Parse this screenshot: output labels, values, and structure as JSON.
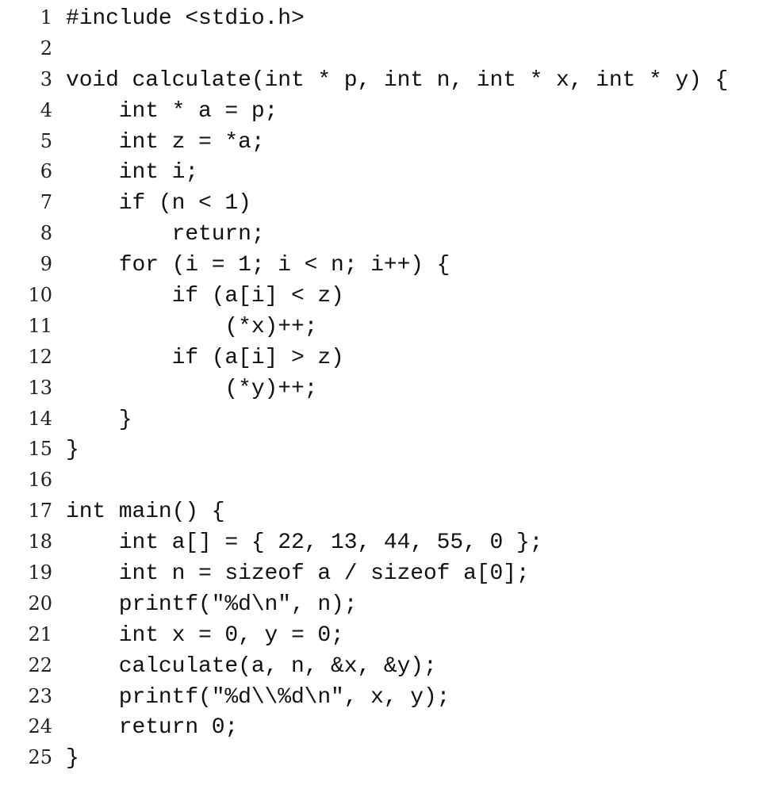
{
  "listing": {
    "language": "C",
    "lines": [
      {
        "number": "1",
        "code": "#include <stdio.h>"
      },
      {
        "number": "2",
        "code": ""
      },
      {
        "number": "3",
        "code": "void calculate(int * p, int n, int * x, int * y) {"
      },
      {
        "number": "4",
        "code": "    int * a = p;"
      },
      {
        "number": "5",
        "code": "    int z = *a;"
      },
      {
        "number": "6",
        "code": "    int i;"
      },
      {
        "number": "7",
        "code": "    if (n < 1)"
      },
      {
        "number": "8",
        "code": "        return;"
      },
      {
        "number": "9",
        "code": "    for (i = 1; i < n; i++) {"
      },
      {
        "number": "10",
        "code": "        if (a[i] < z)"
      },
      {
        "number": "11",
        "code": "            (*x)++;"
      },
      {
        "number": "12",
        "code": "        if (a[i] > z)"
      },
      {
        "number": "13",
        "code": "            (*y)++;"
      },
      {
        "number": "14",
        "code": "    }"
      },
      {
        "number": "15",
        "code": "}"
      },
      {
        "number": "16",
        "code": ""
      },
      {
        "number": "17",
        "code": "int main() {"
      },
      {
        "number": "18",
        "code": "    int a[] = { 22, 13, 44, 55, 0 };"
      },
      {
        "number": "19",
        "code": "    int n = sizeof a / sizeof a[0];"
      },
      {
        "number": "20",
        "code": "    printf(\"%d\\n\", n);"
      },
      {
        "number": "21",
        "code": "    int x = 0, y = 0;"
      },
      {
        "number": "22",
        "code": "    calculate(a, n, &x, &y);"
      },
      {
        "number": "23",
        "code": "    printf(\"%d\\\\%d\\n\", x, y);"
      },
      {
        "number": "24",
        "code": "    return 0;"
      },
      {
        "number": "25",
        "code": "}"
      }
    ]
  }
}
